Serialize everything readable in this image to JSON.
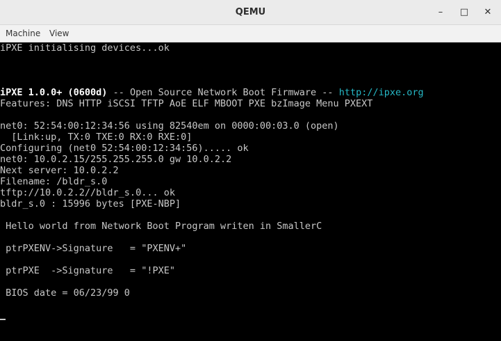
{
  "window": {
    "title": "QEMU",
    "controls": {
      "minimize": "–",
      "maximize": "□",
      "close": "✕"
    }
  },
  "menubar": {
    "items": [
      "Machine",
      "View"
    ]
  },
  "console": {
    "lines": [
      "iPXE initialising devices...ok",
      "",
      "",
      "",
      "",
      "Features: DNS HTTP iSCSI TFTP AoE ELF MBOOT PXE bzImage Menu PXEXT",
      "",
      "net0: 52:54:00:12:34:56 using 82540em on 0000:00:03.0 (open)",
      "  [Link:up, TX:0 TXE:0 RX:0 RXE:0]",
      "Configuring (net0 52:54:00:12:34:56)..... ok",
      "net0: 10.0.2.15/255.255.255.0 gw 10.0.2.2",
      "Next server: 10.0.2.2",
      "Filename: /bldr_s.0",
      "tftp://10.0.2.2//bldr_s.0... ok",
      "bldr_s.0 : 15996 bytes [PXE-NBP]",
      "",
      " Hello world from Network Boot Program writen in SmallerC",
      "",
      " ptrPXENV->Signature   = \"PXENV+\"",
      "",
      " ptrPXE  ->Signature   = \"!PXE\"",
      "",
      " BIOS date = 06/23/99 0"
    ],
    "banner": {
      "name": "iPXE 1.0.0+ (0600d)",
      "middle": " -- Open Source Network Boot Firmware -- ",
      "url": "http://ipxe.org"
    },
    "colors": {
      "text": "#c8c8c8",
      "bold": "#ffffff",
      "link": "#26b8c6",
      "background": "#000000"
    }
  }
}
